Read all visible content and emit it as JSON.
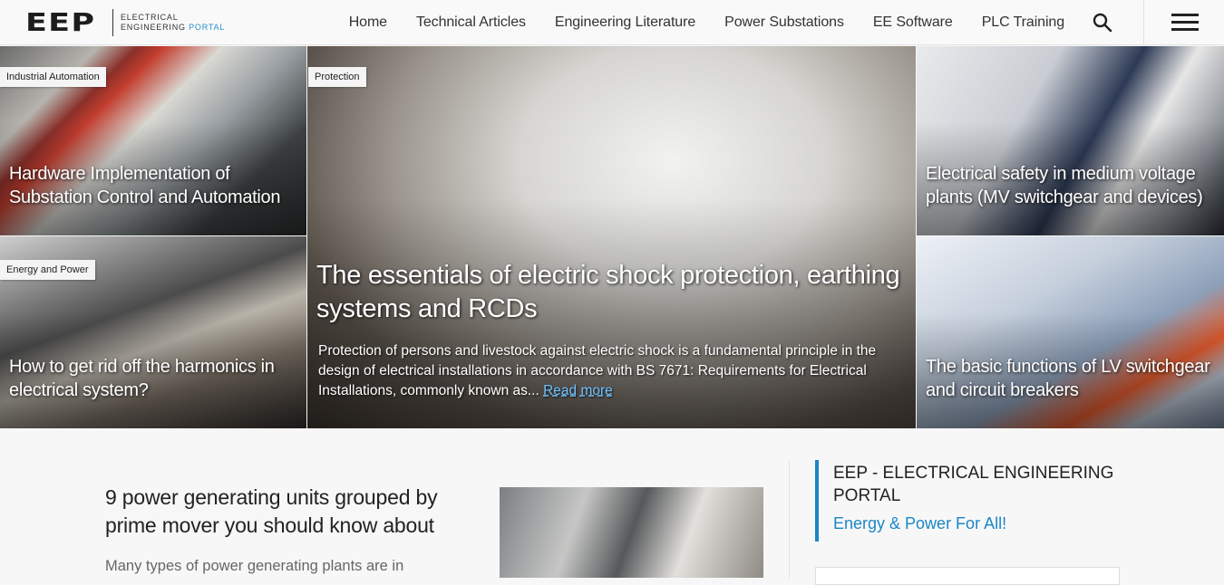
{
  "header": {
    "logo": {
      "mark": "EEP",
      "line1": "ELECTRICAL",
      "line2a": "ENGINEERING ",
      "line2b": "PORTAL"
    },
    "nav": [
      "Home",
      "Technical Articles",
      "Engineering Literature",
      "Power Substations",
      "EE Software",
      "PLC Training"
    ],
    "search_icon": "search-icon",
    "menu_icon": "hamburger-menu-icon"
  },
  "tiles": [
    {
      "category": "Industrial Automation",
      "title": "Hardware Implementation of Substation Control and Automation"
    },
    {
      "category": "Energy and Power",
      "title": "How to get rid off the harmonics in electrical system?"
    },
    {
      "category": "",
      "title": "Electrical safety in medium voltage plants (MV switchgear and devices)"
    },
    {
      "category": "",
      "title": "The basic functions of LV switchgear and circuit breakers"
    }
  ],
  "hero": {
    "category": "Protection",
    "title": "The essentials of electric shock protection, earthing systems and RCDs",
    "excerpt": "Protection of persons and livestock against electric shock is a fundamental principle in the design of electrical installations in accordance with BS 7671: Requirements for Electrical Installations, commonly known as... ",
    "read_more": "Read more"
  },
  "article": {
    "title": "9 power generating units grouped by prime mover you should know about",
    "excerpt": "Many types of power generating plants are in"
  },
  "sidebar": {
    "title": "EEP - ELECTRICAL ENGINEERING PORTAL",
    "subtitle": "Energy & Power For All!"
  },
  "colors": {
    "accent": "#1b86c7",
    "read_more": "#6fc2ff"
  }
}
